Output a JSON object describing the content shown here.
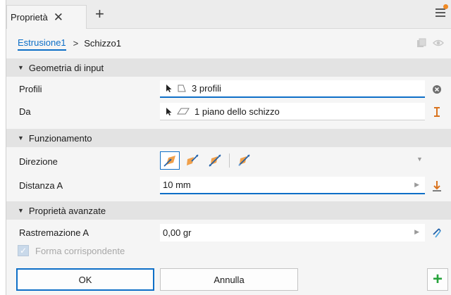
{
  "tab": {
    "label": "Proprietà",
    "close_glyph": "✕",
    "add_glyph": "+"
  },
  "breadcrumb": {
    "parent": "Estrusione1",
    "separator": ">",
    "current": "Schizzo1"
  },
  "sections": {
    "input_geometry": {
      "title": "Geometria di input",
      "rows": {
        "profiles": {
          "label": "Profili",
          "value": "3 profili"
        },
        "from": {
          "label": "Da",
          "value": "1 piano dello schizzo"
        }
      }
    },
    "behavior": {
      "title": "Funzionamento",
      "rows": {
        "direction": {
          "label": "Direzione"
        },
        "distance": {
          "label": "Distanza A",
          "value": "10 mm"
        }
      }
    },
    "advanced": {
      "title": "Proprietà avanzate",
      "rows": {
        "taper": {
          "label": "Rastremazione A",
          "value": "0,00 gr"
        },
        "match_shape": {
          "label": "Forma corrispondente",
          "checked": true
        }
      }
    }
  },
  "buttons": {
    "ok": "OK",
    "cancel": "Annulla",
    "add": "+"
  },
  "icons": {
    "menu": "hamburger-menu-icon",
    "select_cursor": "cursor-arrow-icon",
    "profile": "profile-shape-icon",
    "plane": "plane-icon",
    "clear": "clear-x-icon",
    "flip": "flip-direction-icon",
    "direction_default": "direction-default-icon",
    "direction_flipped": "direction-flipped-icon",
    "direction_symmetric": "direction-symmetric-icon",
    "direction_asymmetric": "direction-asymmetric-icon",
    "extent": "extent-icon",
    "taper": "taper-icon"
  },
  "colors": {
    "accent": "#0e6fc7",
    "notify": "#f08a24",
    "add_green": "#27a33b",
    "extrude_orange": "#f0a04b"
  }
}
